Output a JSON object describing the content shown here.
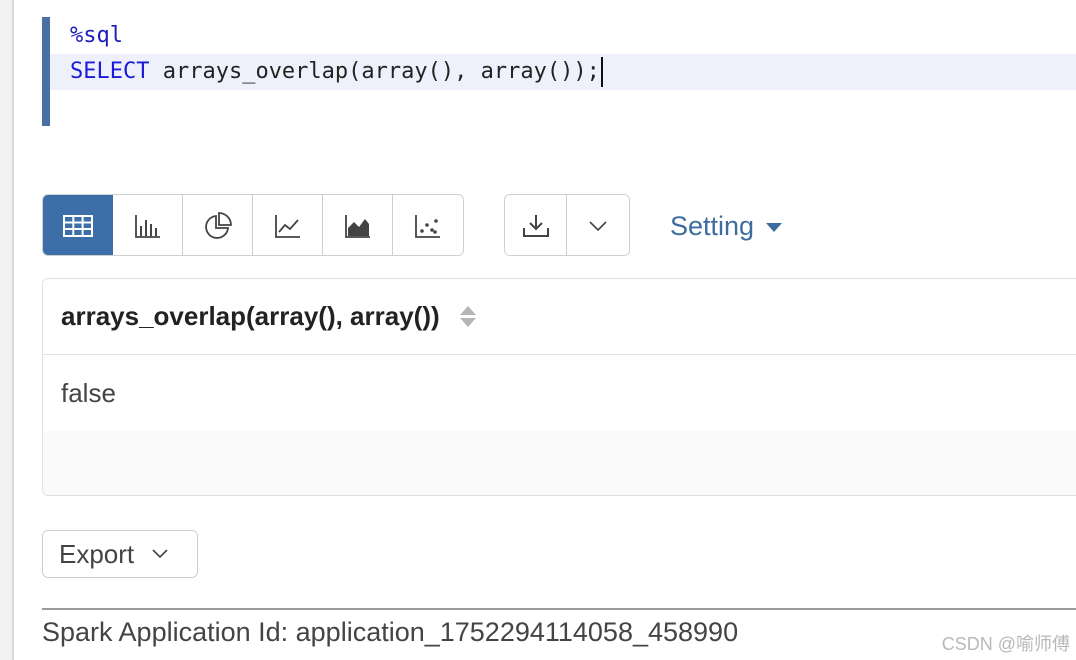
{
  "editor": {
    "magic": "%sql",
    "line2_keyword": "SELECT",
    "line2_rest": " arrays_overlap(array(), array());"
  },
  "toolbar": {
    "viz_buttons": [
      {
        "icon": "table-icon",
        "active": true
      },
      {
        "icon": "bar-chart-icon",
        "active": false
      },
      {
        "icon": "pie-chart-icon",
        "active": false
      },
      {
        "icon": "line-chart-icon",
        "active": false
      },
      {
        "icon": "area-chart-icon",
        "active": false
      },
      {
        "icon": "scatter-chart-icon",
        "active": false
      }
    ],
    "download_icon": "download-icon",
    "download_caret_icon": "chevron-down-icon",
    "setting_label": "Setting"
  },
  "table": {
    "column_header": "arrays_overlap(array(), array())",
    "rows": [
      "false"
    ]
  },
  "export": {
    "label": "Export"
  },
  "footer": {
    "spark_app_id": "Spark Application Id: application_1752294114058_458990"
  },
  "watermark": "CSDN @喻师傅",
  "colors": {
    "accent": "#3c6fa8",
    "link": "#3d6d9e",
    "keyword": "#1a1adb",
    "active_line": "#eef1fb"
  }
}
